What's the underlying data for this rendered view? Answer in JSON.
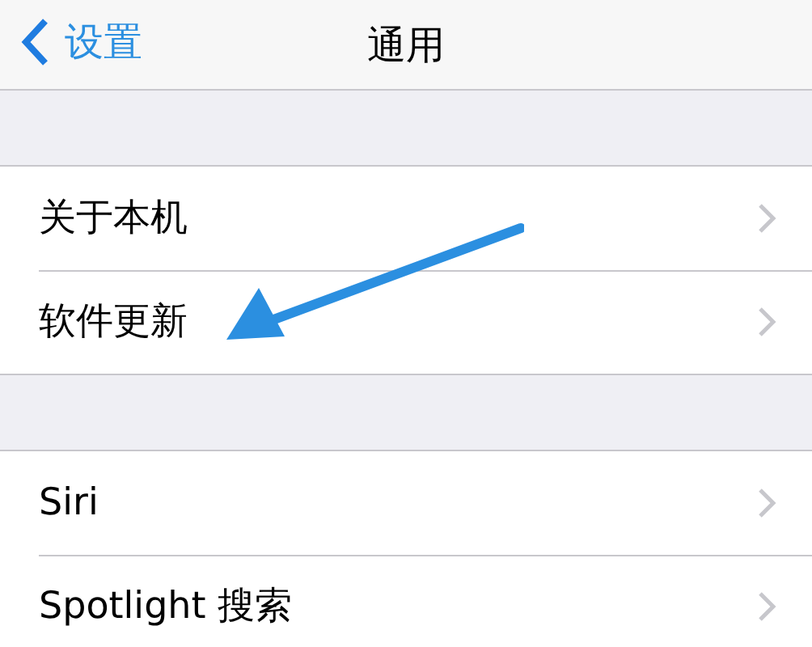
{
  "nav": {
    "back_label": "设置",
    "title": "通用"
  },
  "groups": [
    {
      "rows": [
        {
          "label": "关于本机"
        },
        {
          "label": "软件更新"
        }
      ]
    },
    {
      "rows": [
        {
          "label": "Siri"
        },
        {
          "label": "Spotlight 搜索"
        }
      ]
    }
  ]
}
